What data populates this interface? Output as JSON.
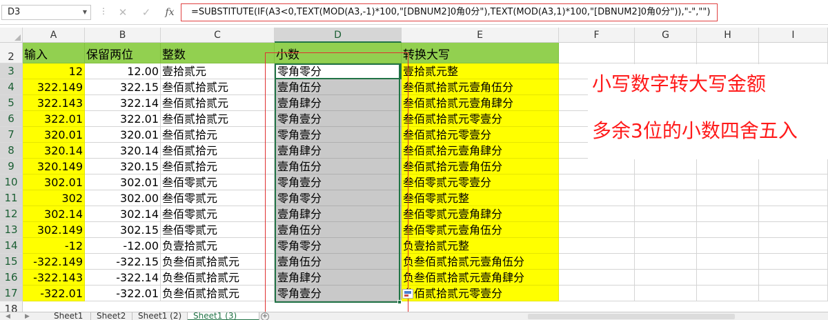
{
  "name_box": "D3",
  "formula": "=SUBSTITUTE(IF(A3<0,TEXT(MOD(A3,-1)*100,\"[DBNUM2]0角0分\"),TEXT(MOD(A3,1)*100,\"[DBNUM2]0角0分\")),\"-\",\"\")",
  "fx_label": "fx",
  "columns": [
    "A",
    "B",
    "C",
    "D",
    "E",
    "F",
    "G",
    "H",
    "I"
  ],
  "headers": {
    "a": "输入",
    "b": "保留两位",
    "c": "整数",
    "d": "小数",
    "e": "转换大写"
  },
  "rows": [
    {
      "n": "3",
      "a": "12",
      "b": "12.00",
      "c": "壹拾贰元",
      "d": "零角零分",
      "e": "壹拾贰元整"
    },
    {
      "n": "4",
      "a": "322.149",
      "b": "322.15",
      "c": "叁佰贰拾贰元",
      "d": "壹角伍分",
      "e": "叁佰贰拾贰元壹角伍分"
    },
    {
      "n": "5",
      "a": "322.143",
      "b": "322.14",
      "c": "叁佰贰拾贰元",
      "d": "壹角肆分",
      "e": "叁佰贰拾贰元壹角肆分"
    },
    {
      "n": "6",
      "a": "322.01",
      "b": "322.01",
      "c": "叁佰贰拾贰元",
      "d": "零角壹分",
      "e": "叁佰贰拾贰元零壹分"
    },
    {
      "n": "7",
      "a": "320.01",
      "b": "320.01",
      "c": "叁佰贰拾元",
      "d": "零角壹分",
      "e": "叁佰贰拾元零壹分"
    },
    {
      "n": "8",
      "a": "320.14",
      "b": "320.14",
      "c": "叁佰贰拾元",
      "d": "壹角肆分",
      "e": "叁佰贰拾元壹角肆分"
    },
    {
      "n": "9",
      "a": "320.149",
      "b": "320.15",
      "c": "叁佰贰拾元",
      "d": "壹角伍分",
      "e": "叁佰贰拾元壹角伍分"
    },
    {
      "n": "10",
      "a": "302.01",
      "b": "302.01",
      "c": "叁佰零贰元",
      "d": "零角壹分",
      "e": "叁佰零贰元零壹分"
    },
    {
      "n": "11",
      "a": "302",
      "b": "302.00",
      "c": "叁佰零贰元",
      "d": "零角零分",
      "e": "叁佰零贰元整"
    },
    {
      "n": "12",
      "a": "302.14",
      "b": "302.14",
      "c": "叁佰零贰元",
      "d": "壹角肆分",
      "e": "叁佰零贰元壹角肆分"
    },
    {
      "n": "13",
      "a": "302.149",
      "b": "302.15",
      "c": "叁佰零贰元",
      "d": "壹角伍分",
      "e": "叁佰零贰元壹角伍分"
    },
    {
      "n": "14",
      "a": "-12",
      "b": "-12.00",
      "c": "负壹拾贰元",
      "d": "零角零分",
      "e": "负壹拾贰元整"
    },
    {
      "n": "15",
      "a": "-322.149",
      "b": "-322.15",
      "c": "负叁佰贰拾贰元",
      "d": "壹角伍分",
      "e": "负叁佰贰拾贰元壹角伍分"
    },
    {
      "n": "16",
      "a": "-322.143",
      "b": "-322.14",
      "c": "负叁佰贰拾贰元",
      "d": "壹角肆分",
      "e": "负叁佰贰拾贰元壹角肆分"
    },
    {
      "n": "17",
      "a": "-322.01",
      "b": "-322.01",
      "c": "负叁佰贰拾贰元",
      "d": "零角壹分",
      "e": "叁佰贰拾贰元零壹分"
    }
  ],
  "row_numbers": {
    "r2": "2",
    "r18": "18"
  },
  "annotations": {
    "line1": "小写数字转大写金额",
    "line2": "多余3位的小数四舍五入"
  },
  "sheet_tabs": [
    "Sheet1",
    "Sheet2",
    "Sheet1 (2)",
    "Sheet1 (3)"
  ],
  "active_sheet": "Sheet1 (3)",
  "add_sheet_label": "+",
  "colors": {
    "input_yellow": "#ffff00",
    "header_green": "#92d050",
    "selected_grey": "#c9c9c9",
    "annotation_red": "#ff1a1a",
    "excel_green": "#217346"
  }
}
